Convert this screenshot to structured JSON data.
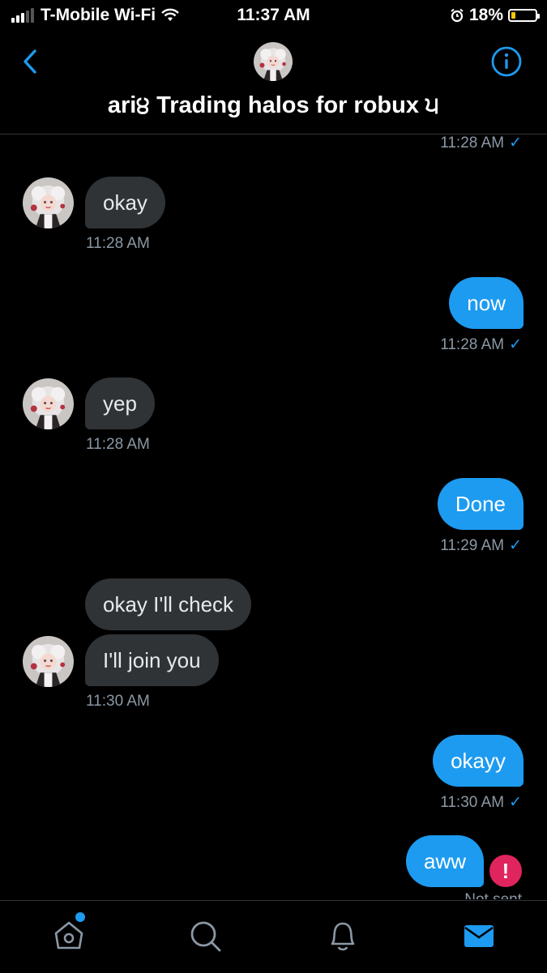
{
  "status_bar": {
    "carrier": "T-Mobile Wi-Fi",
    "time": "11:37 AM",
    "battery_percent": "18%",
    "battery_level": 0.18
  },
  "header": {
    "title": "ari੪ Trading halos for robux ੫"
  },
  "messages": [
    {
      "from": "me",
      "timestamp": "11:28 AM"
    },
    {
      "from": "them",
      "text": "okay",
      "timestamp": "11:28 AM"
    },
    {
      "from": "me",
      "text": "now",
      "timestamp": "11:28 AM"
    },
    {
      "from": "them",
      "text": "yep",
      "timestamp": "11:28 AM"
    },
    {
      "from": "me",
      "text": "Done",
      "timestamp": "11:29 AM"
    },
    {
      "from": "them",
      "text": "okay I'll check"
    },
    {
      "from": "them",
      "text": "I'll join you",
      "timestamp": "11:30 AM"
    },
    {
      "from": "me",
      "text": "okayy",
      "timestamp": "11:30 AM"
    },
    {
      "from": "me",
      "text": "aww",
      "status": "Not sent",
      "error_icon": "!"
    }
  ],
  "check_glyph": "✓",
  "tabbar": {
    "items": [
      "home-icon",
      "search-icon",
      "notifications-icon",
      "messages-icon"
    ],
    "active": "messages-icon",
    "home_has_dot": true
  },
  "colors": {
    "accent": "#1d9bf0",
    "incoming_bubble": "#2f3336",
    "error": "#e0245e",
    "background": "#000000"
  }
}
